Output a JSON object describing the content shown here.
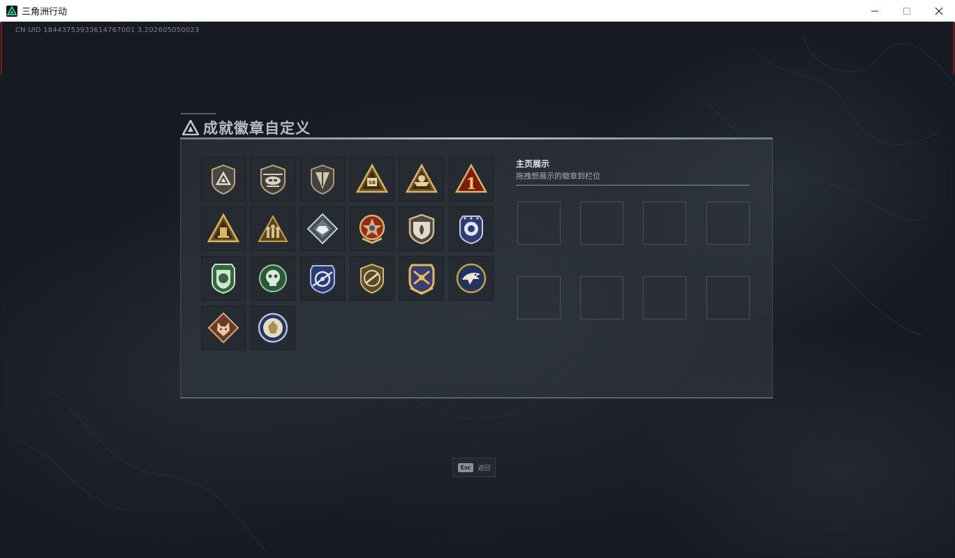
{
  "window": {
    "title": "三角洲行动",
    "minimize_icon": "minimize-icon",
    "maximize_icon": "maximize-icon",
    "close_icon": "close-icon"
  },
  "game": {
    "uid": "CN UID 18443753933614767001 3.202605050023"
  },
  "dialog": {
    "title": "成就徽章自定义",
    "title_icon": "delta-triangle-icon",
    "badges": [
      {
        "name": "badge-delta-shield",
        "icon": "delta-shield-icon"
      },
      {
        "name": "badge-helicopter",
        "icon": "helicopter-icon"
      },
      {
        "name": "badge-arrow-shield",
        "icon": "arrow-shield-icon"
      },
      {
        "name": "badge-sb-triangle",
        "icon": "sb-triangle-icon",
        "label": "SB"
      },
      {
        "name": "badge-boat-triangle",
        "icon": "boat-triangle-icon"
      },
      {
        "name": "badge-number-one",
        "icon": "number-one-triangle-icon",
        "label": "1"
      },
      {
        "name": "badge-tower-triangle",
        "icon": "tower-triangle-icon"
      },
      {
        "name": "badge-soldiers-triangle",
        "icon": "soldiers-triangle-icon"
      },
      {
        "name": "badge-crystal-diamond",
        "icon": "crystal-diamond-icon"
      },
      {
        "name": "badge-star-medal",
        "icon": "star-medal-icon"
      },
      {
        "name": "badge-leaf-shield",
        "icon": "leaf-shield-icon"
      },
      {
        "name": "badge-blue-star-shield",
        "icon": "blue-star-shield-icon"
      },
      {
        "name": "badge-green-tree",
        "icon": "green-tree-shield-icon"
      },
      {
        "name": "badge-green-skull",
        "icon": "green-skull-icon"
      },
      {
        "name": "badge-blue-target",
        "icon": "blue-target-shield-icon"
      },
      {
        "name": "badge-rifle-round",
        "icon": "rifle-round-icon"
      },
      {
        "name": "badge-gold-weapons",
        "icon": "gold-weapons-shield-icon"
      },
      {
        "name": "badge-eagle-round",
        "icon": "eagle-round-icon"
      },
      {
        "name": "badge-wolf-diamond",
        "icon": "wolf-diamond-icon"
      },
      {
        "name": "badge-lion-round",
        "icon": "lion-round-icon"
      }
    ],
    "showcase": {
      "title": "主页展示",
      "subtitle": "拖拽想展示的徽章到栏位",
      "slot_count": 8
    }
  },
  "footer": {
    "esc_key": "Esc",
    "esc_label": "返回"
  },
  "colors": {
    "accent_gold": "#c9a14a",
    "accent_blue": "#4e6ba8",
    "accent_green": "#4d8a55",
    "background": "#181c22"
  }
}
